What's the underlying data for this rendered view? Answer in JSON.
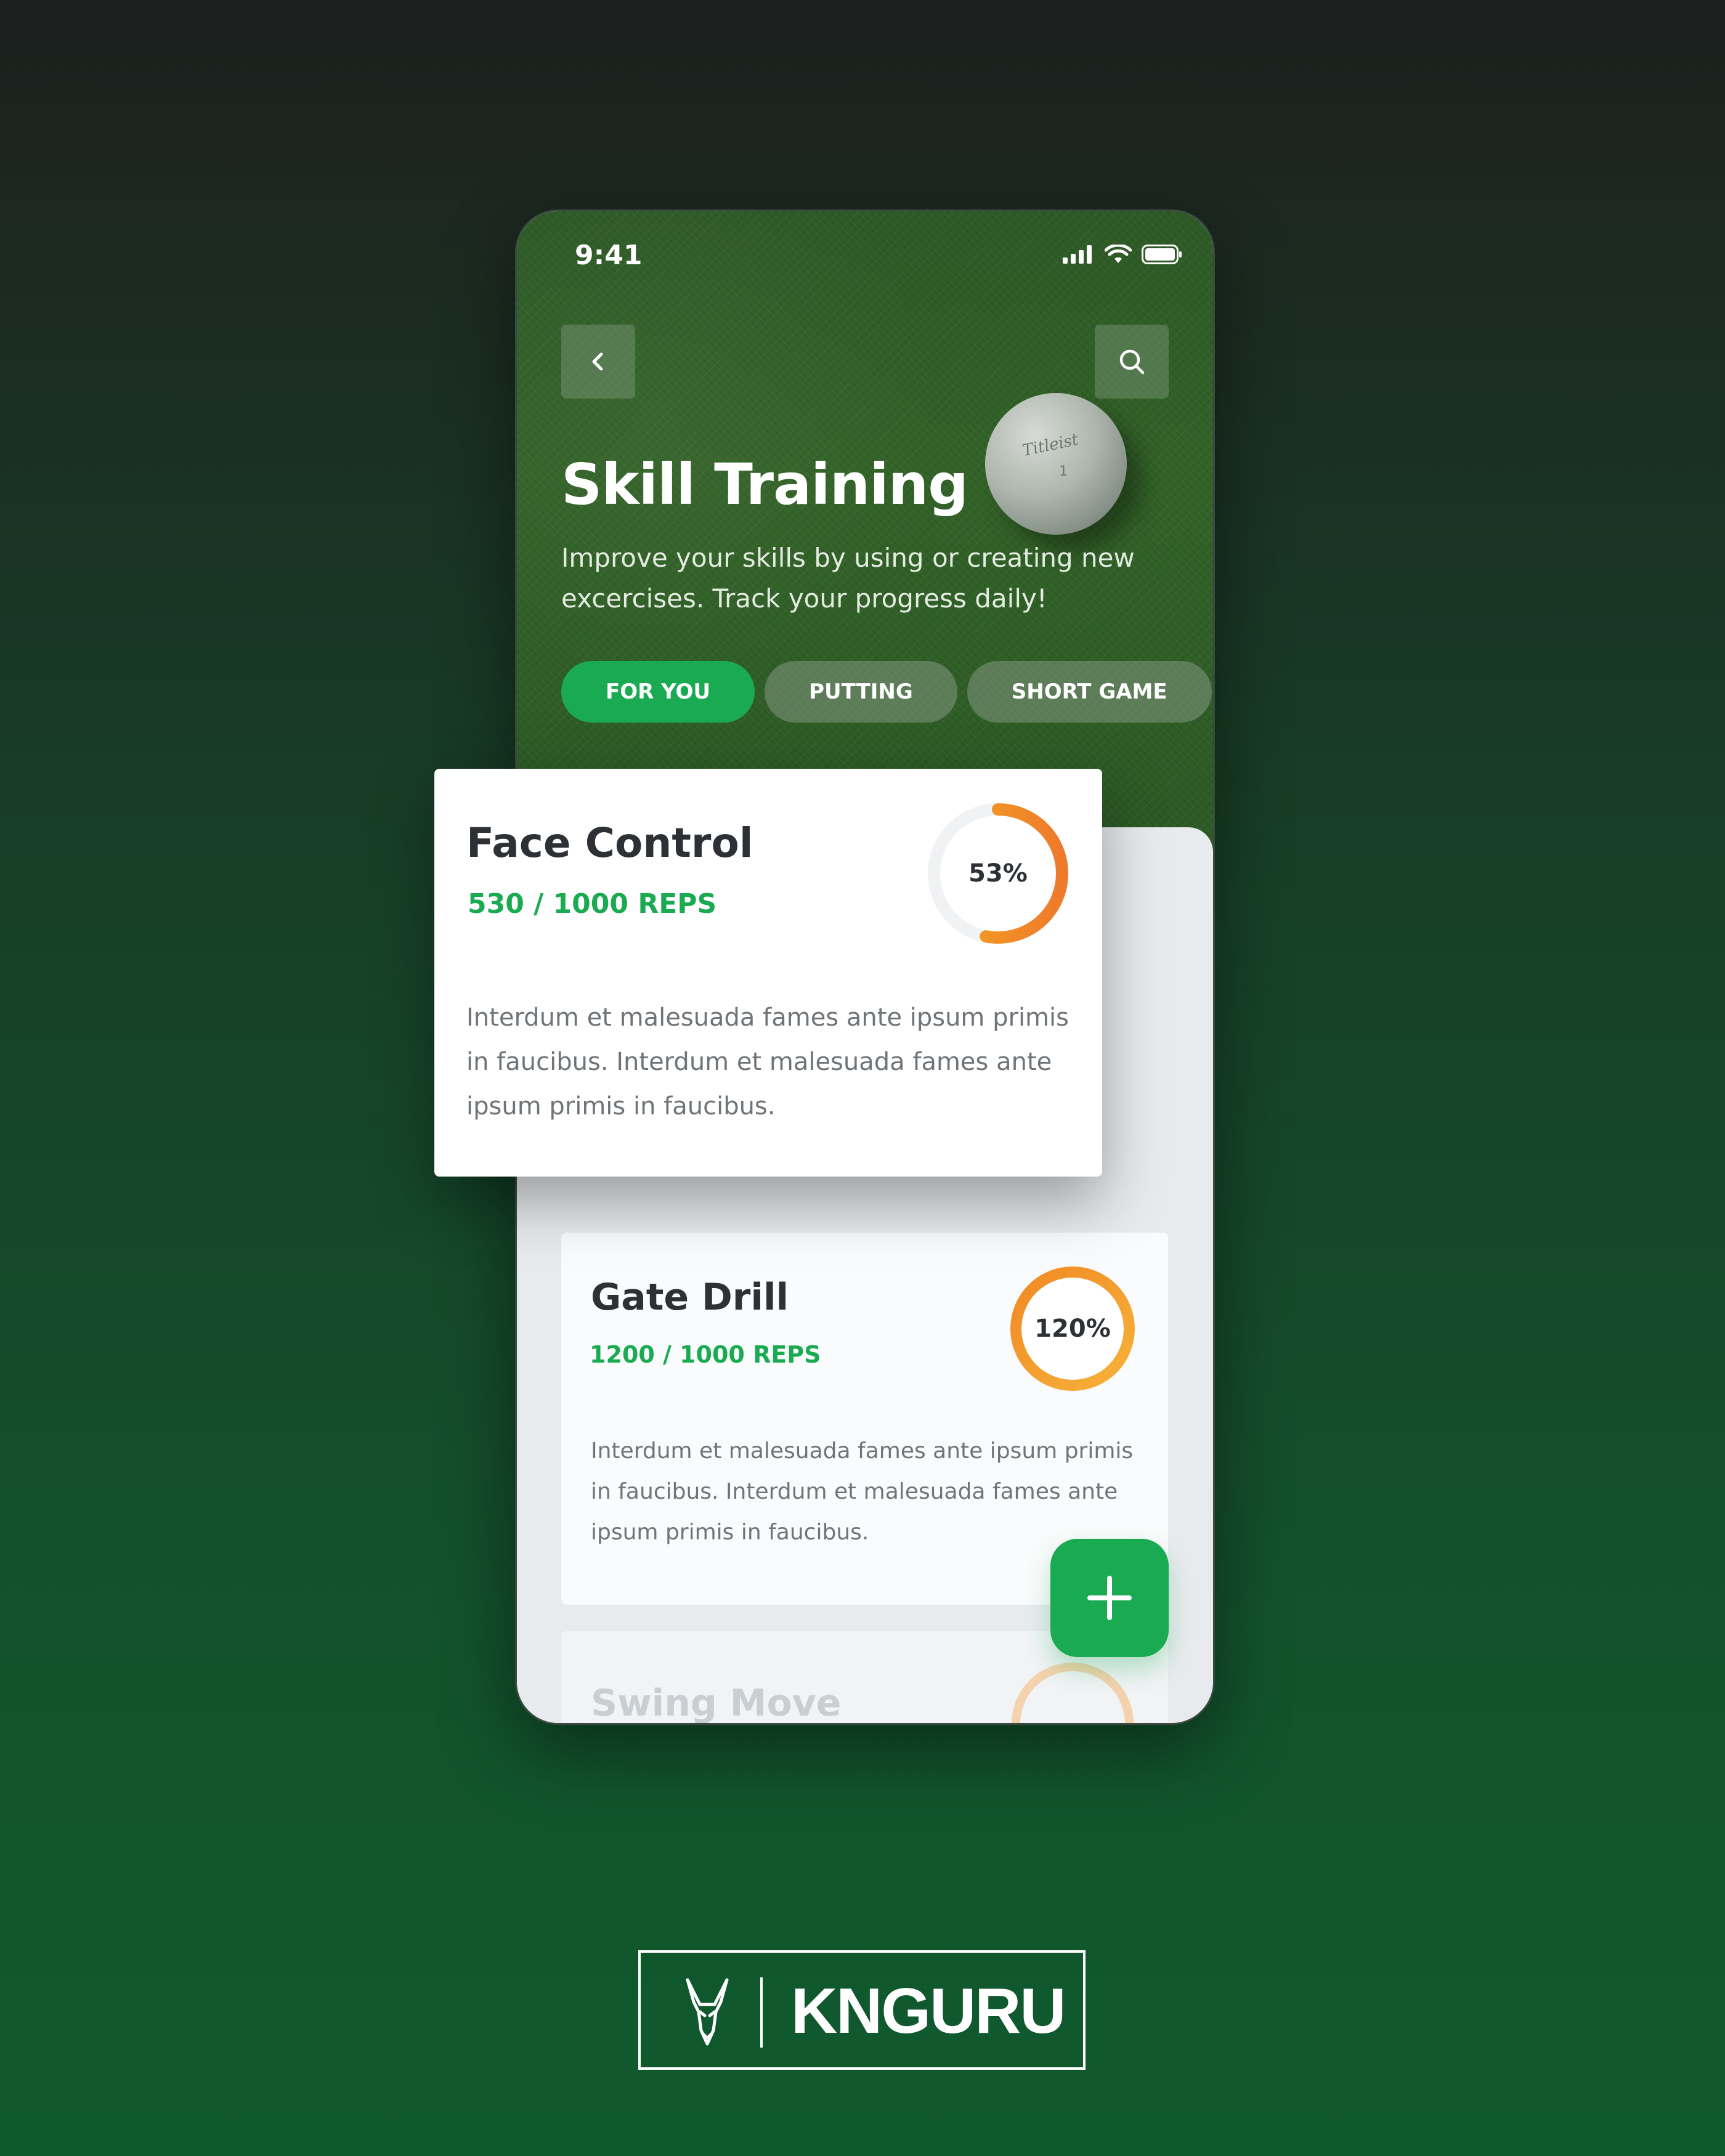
{
  "status": {
    "time": "9:41"
  },
  "header": {
    "title": "Skill Training",
    "subtitle": "Improve your skills by using or creating new excercises. Track your progress daily!"
  },
  "ball": {
    "text": "Titleist",
    "number": "1"
  },
  "tabs": [
    {
      "label": "FOR YOU",
      "active": true
    },
    {
      "label": "PUTTING",
      "active": false
    },
    {
      "label": "SHORT GAME",
      "active": false
    }
  ],
  "cards": [
    {
      "title": "Face Control",
      "reps": "530 / 1000 REPS",
      "progress_label": "53%",
      "progress": 0.53,
      "description": "Interdum et malesuada fames  ante ipsum primis in faucibus. Interdum et malesuada fames ante ipsum primis in faucibus."
    },
    {
      "title": "Gate Drill",
      "reps": "1200 / 1000 REPS",
      "progress_label": "120%",
      "progress": 1.2,
      "description": "Interdum et malesuada fames  ante ipsum primis in faucibus. Interdum et malesuada fames ante ipsum primis in faucibus."
    },
    {
      "title": "Swing Move"
    }
  ],
  "brand": {
    "name": "KNGURU"
  },
  "colors": {
    "accent": "#1aaa52",
    "progress_orange": "#f08a24",
    "progress_yellow": "#f7b23b"
  }
}
